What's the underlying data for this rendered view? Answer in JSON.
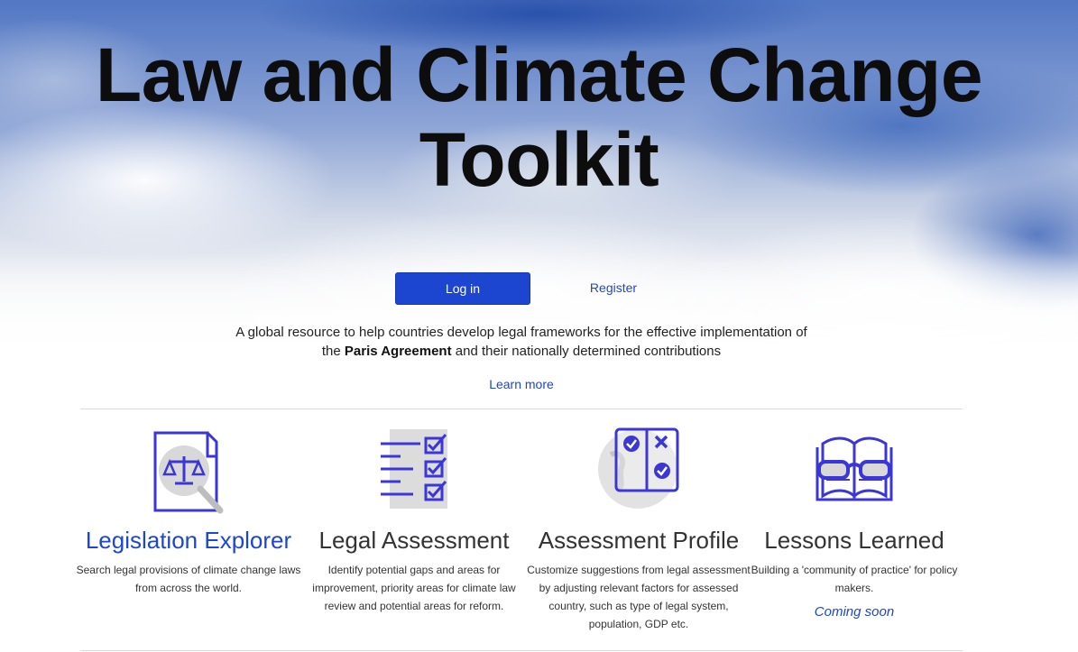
{
  "hero": {
    "title_line1": "Law and Climate Change",
    "title_line2": "Toolkit"
  },
  "auth": {
    "login_label": "Log in",
    "register_label": "Register"
  },
  "intro": {
    "text_before": "A global resource to help countries develop legal frameworks for the effective implementation of the ",
    "text_bold": "Paris Agreement",
    "text_after": " and their nationally determined contributions",
    "learn_more": "Learn more"
  },
  "features": [
    {
      "title": "Legislation Explorer",
      "desc": "Search legal provisions of climate change laws from across the world.",
      "icon": "legislation-explorer-icon"
    },
    {
      "title": "Legal Assessment",
      "desc": "Identify potential gaps and areas for improvement, priority areas for climate law review and potential areas for reform.",
      "icon": "legal-assessment-icon"
    },
    {
      "title": "Assessment Profile",
      "desc": "Customize suggestions from legal assessment by adjusting relevant factors for assessed country, such as type of legal system, population, GDP etc.",
      "icon": "assessment-profile-icon"
    },
    {
      "title": "Lessons Learned",
      "desc": "Building a 'community of practice' for policy makers.",
      "icon": "lessons-learned-icon",
      "status": "Coming soon"
    }
  ],
  "colors": {
    "accent": "#1d46d0",
    "icon_stroke": "#3b36d6",
    "text": "#333333"
  }
}
